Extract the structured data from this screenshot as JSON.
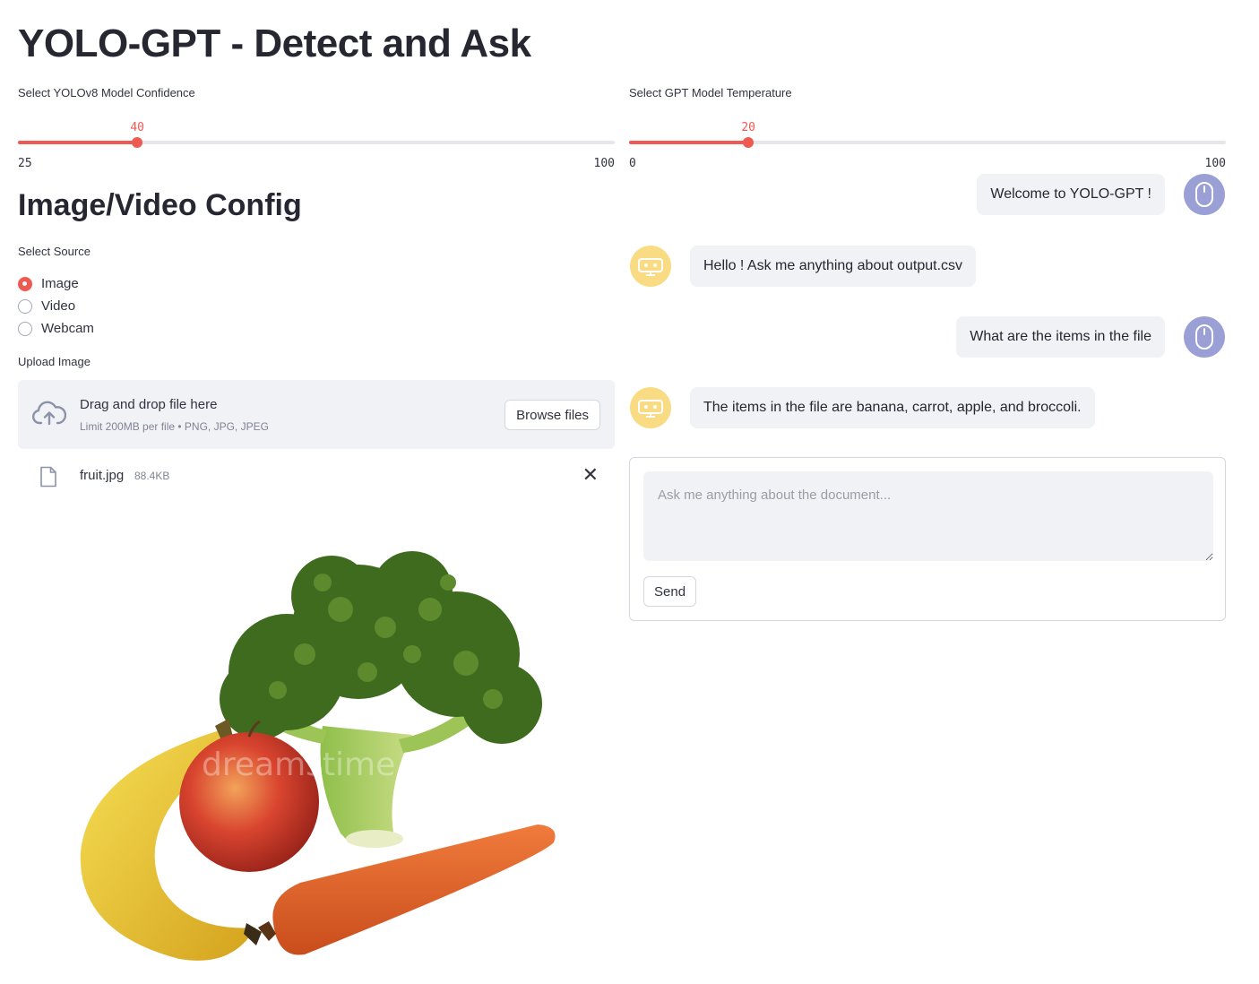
{
  "page": {
    "title": "YOLO-GPT - Detect and Ask"
  },
  "confidence_slider": {
    "label": "Select YOLOv8 Model Confidence",
    "value": 40,
    "min": 25,
    "max": 100
  },
  "temperature_slider": {
    "label": "Select GPT Model Temperature",
    "value": 20,
    "min": 0,
    "max": 100
  },
  "config": {
    "section_title": "Image/Video Config",
    "source_label": "Select Source",
    "sources": [
      {
        "label": "Image",
        "selected": true
      },
      {
        "label": "Video",
        "selected": false
      },
      {
        "label": "Webcam",
        "selected": false
      }
    ],
    "upload_label": "Upload Image",
    "dropzone": {
      "title": "Drag and drop file here",
      "limit": "Limit 200MB per file • PNG, JPG, JPEG",
      "browse_label": "Browse files"
    },
    "file": {
      "name": "fruit.jpg",
      "size": "88.4KB"
    },
    "image_watermark": "dreamstime"
  },
  "chat": {
    "messages": [
      {
        "role": "user",
        "text": "Welcome to YOLO-GPT !"
      },
      {
        "role": "bot",
        "text": "Hello ! Ask me anything about output.csv"
      },
      {
        "role": "user",
        "text": "What are the items in the file"
      },
      {
        "role": "bot",
        "text": "The items in the file are banana, carrot, apple, and broccoli."
      }
    ],
    "input_placeholder": "Ask me anything about the document...",
    "send_label": "Send"
  },
  "colors": {
    "accent": "#ee5a52",
    "user_avatar": "#9a9fd6",
    "bot_avatar": "#f9db84",
    "bubble": "#f0f2f6"
  }
}
